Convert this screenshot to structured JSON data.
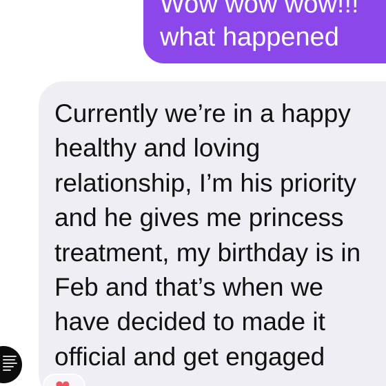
{
  "conversation": {
    "sent_message": {
      "lines": [
        "Wow wow wow!!!",
        "what happened"
      ]
    },
    "received_message": {
      "lines": [
        "Currently we’re in a happy",
        "healthy and loving",
        "relationship, I’m his priority",
        "and he gives me princess",
        "treatment, my birthday is in",
        "Feb and that’s when we",
        "have decided to made it",
        "official and get engaged"
      ]
    },
    "reaction": {
      "icon": "heart-icon",
      "glyph": "❤"
    },
    "avatar": {
      "icon": "avatar-text-image"
    }
  },
  "colors": {
    "sent_bubble": "#8b47ea",
    "received_bubble": "#efeef4",
    "reaction_heart": "#f2535e"
  }
}
